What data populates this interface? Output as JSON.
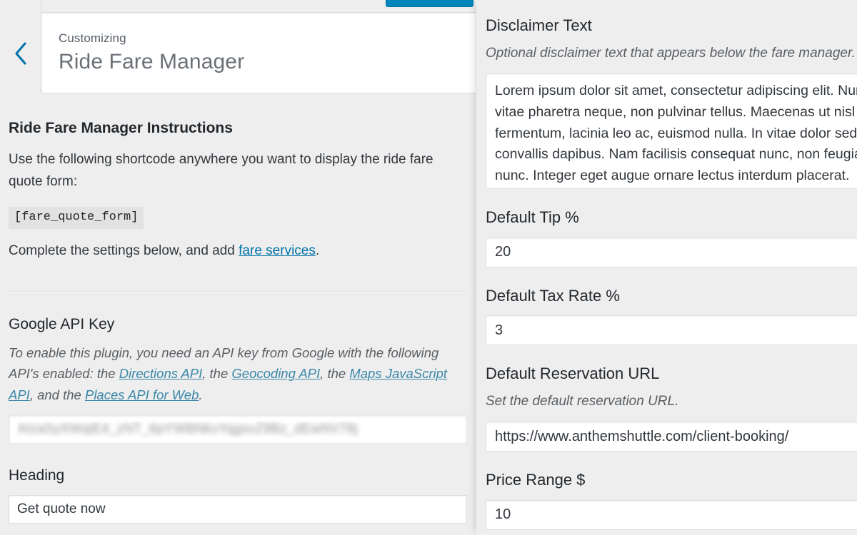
{
  "window": {
    "app": "WordPress Customizer",
    "publish_button_label": ""
  },
  "sidebar": {
    "back_icon": "chevron-left-icon",
    "customizing_label": "Customizing",
    "panel_title": "Ride Fare Manager",
    "instructions": {
      "heading": "Ride Fare Manager Instructions",
      "paragraph_1": "Use the following shortcode anywhere you want to display the ride fare quote form:",
      "shortcode": "[fare_quote_form]",
      "paragraph_2_prefix": "Complete the settings below, and add ",
      "paragraph_2_link": "fare services",
      "paragraph_2_suffix": "."
    },
    "google_api_key": {
      "label": "Google API Key",
      "desc_part_1": "To enable this plugin, you need an API key from Google with the following API's enabled: the ",
      "link_1": "Directions API",
      "desc_part_2": ", the ",
      "link_2": "Geocoding API",
      "desc_part_3": ", the ",
      "link_3": "Maps JavaScript API",
      "desc_part_4": ", and the ",
      "link_4": "Places API for Web",
      "desc_part_5": ".",
      "value": "AIzaSyXWqiE4_zNT_6pYWBNkvYqgsvZ9Bz_dEwNV78j"
    },
    "heading_field": {
      "label": "Heading",
      "value": "Get quote now"
    }
  },
  "right_panel": {
    "disclaimer": {
      "label": "Disclaimer Text",
      "desc": "Optional disclaimer text that appears below the fare manager.",
      "value": "Lorem ipsum dolor sit amet, consectetur adipiscing elit. Nunc vitae pharetra neque, non pulvinar tellus. Maecenas ut nisl fermentum, lacinia leo ac, euismod nulla. In vitae dolor sed ex convallis dapibus. Nam facilisis consequat nunc, non feugiat nunc. Integer eget augue ornare lectus interdum placerat."
    },
    "default_tip": {
      "label": "Default Tip %",
      "value": "20"
    },
    "default_tax_rate": {
      "label": "Default Tax Rate %",
      "value": "3"
    },
    "reservation_url": {
      "label": "Default Reservation URL",
      "desc": "Set the default reservation URL.",
      "value": "https://www.anthemshuttle.com/client-booking/"
    },
    "price_range": {
      "label": "Price Range $",
      "value": "10"
    }
  },
  "colors": {
    "accent_blue": "#0085ba",
    "link_blue": "#0073aa",
    "panel_bg": "#eeeeee",
    "white": "#ffffff",
    "border": "#dddddd",
    "text_dark": "#23282d",
    "text_muted": "#5a5f64"
  }
}
